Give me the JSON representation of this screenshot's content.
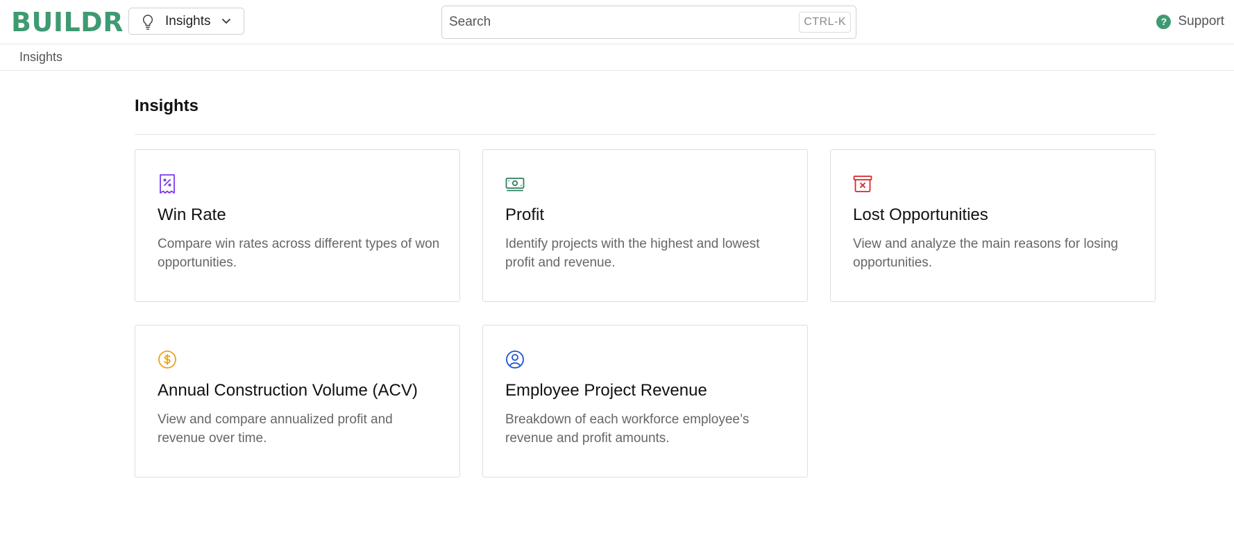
{
  "app": {
    "logo": "BUILDR"
  },
  "module_switch": {
    "label": "Insights",
    "icon": "lightbulb-icon"
  },
  "search": {
    "placeholder": "Search",
    "shortcut": "CTRL-K"
  },
  "support": {
    "label": "Support",
    "icon": "help-circle-icon",
    "icon_glyph": "?"
  },
  "breadcrumb": {
    "current": "Insights"
  },
  "page": {
    "title": "Insights"
  },
  "cards": [
    {
      "title": "Win Rate",
      "description": "Compare win rates across different types of won opportunities.",
      "icon": "receipt-percent-icon",
      "color": "#7c3aed"
    },
    {
      "title": "Profit",
      "description": "Identify projects with the highest and lowest profit and revenue.",
      "icon": "banknotes-icon",
      "color": "#2f7f5f"
    },
    {
      "title": "Lost Opportunities",
      "description": "View and analyze the main reasons for losing opportunities.",
      "icon": "archive-box-x-icon",
      "color": "#dc2626"
    },
    {
      "title": "Annual Construction Volume (ACV)",
      "description": "View and compare annualized profit and revenue over time.",
      "icon": "currency-dollar-icon",
      "color": "#e8a317"
    },
    {
      "title": "Employee Project Revenue",
      "description": "Breakdown of each workforce employee’s revenue and profit amounts.",
      "icon": "user-circle-icon",
      "color": "#1d4ed8"
    }
  ],
  "colors": {
    "brand": "#3f9a72",
    "border": "#dedede",
    "muted_text": "#666666"
  }
}
